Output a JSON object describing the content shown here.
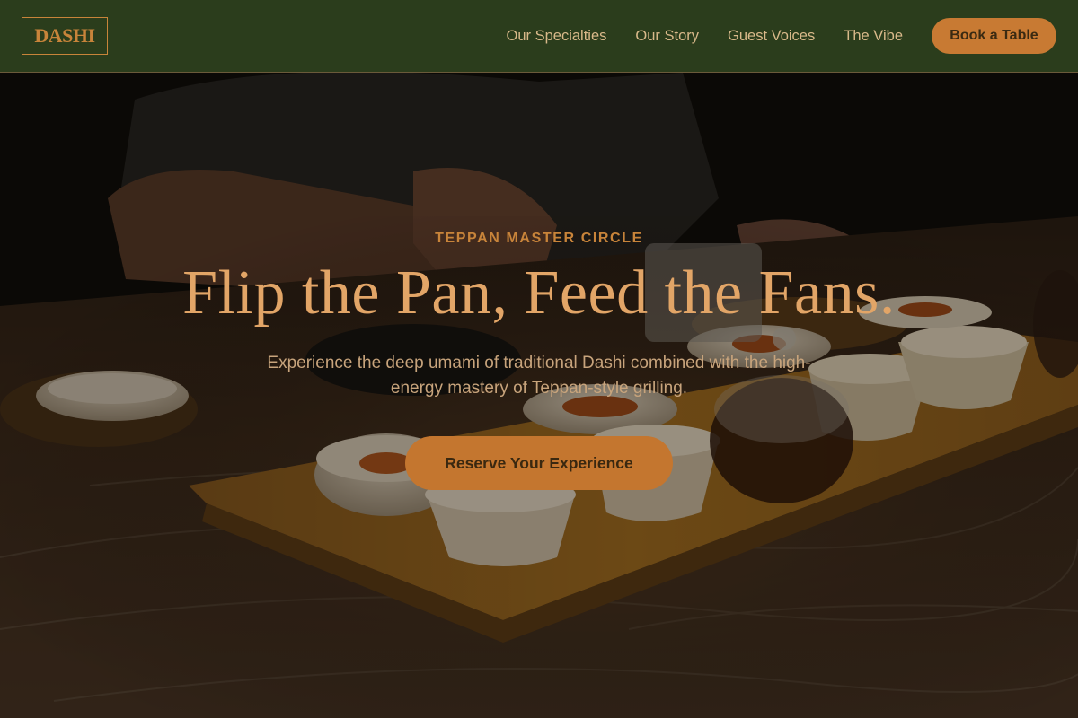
{
  "brand": {
    "name": "DASHI"
  },
  "nav": {
    "links": [
      "Our Specialties",
      "Our Story",
      "Guest Voices",
      "The Vibe"
    ],
    "cta_label": "Book a Table"
  },
  "hero": {
    "eyebrow": "TEPPAN MASTER CIRCLE",
    "headline": "Flip the Pan, Feed the Fans.",
    "subline": "Experience the deep umami of traditional Dashi combined with the high-energy mastery of Teppan-style grilling.",
    "cta_label": "Reserve Your Experience"
  },
  "colors": {
    "header_bg": "#2b3d1c",
    "accent": "#c8843a",
    "button": "#c87a33",
    "nav_text": "#d9b98a"
  }
}
